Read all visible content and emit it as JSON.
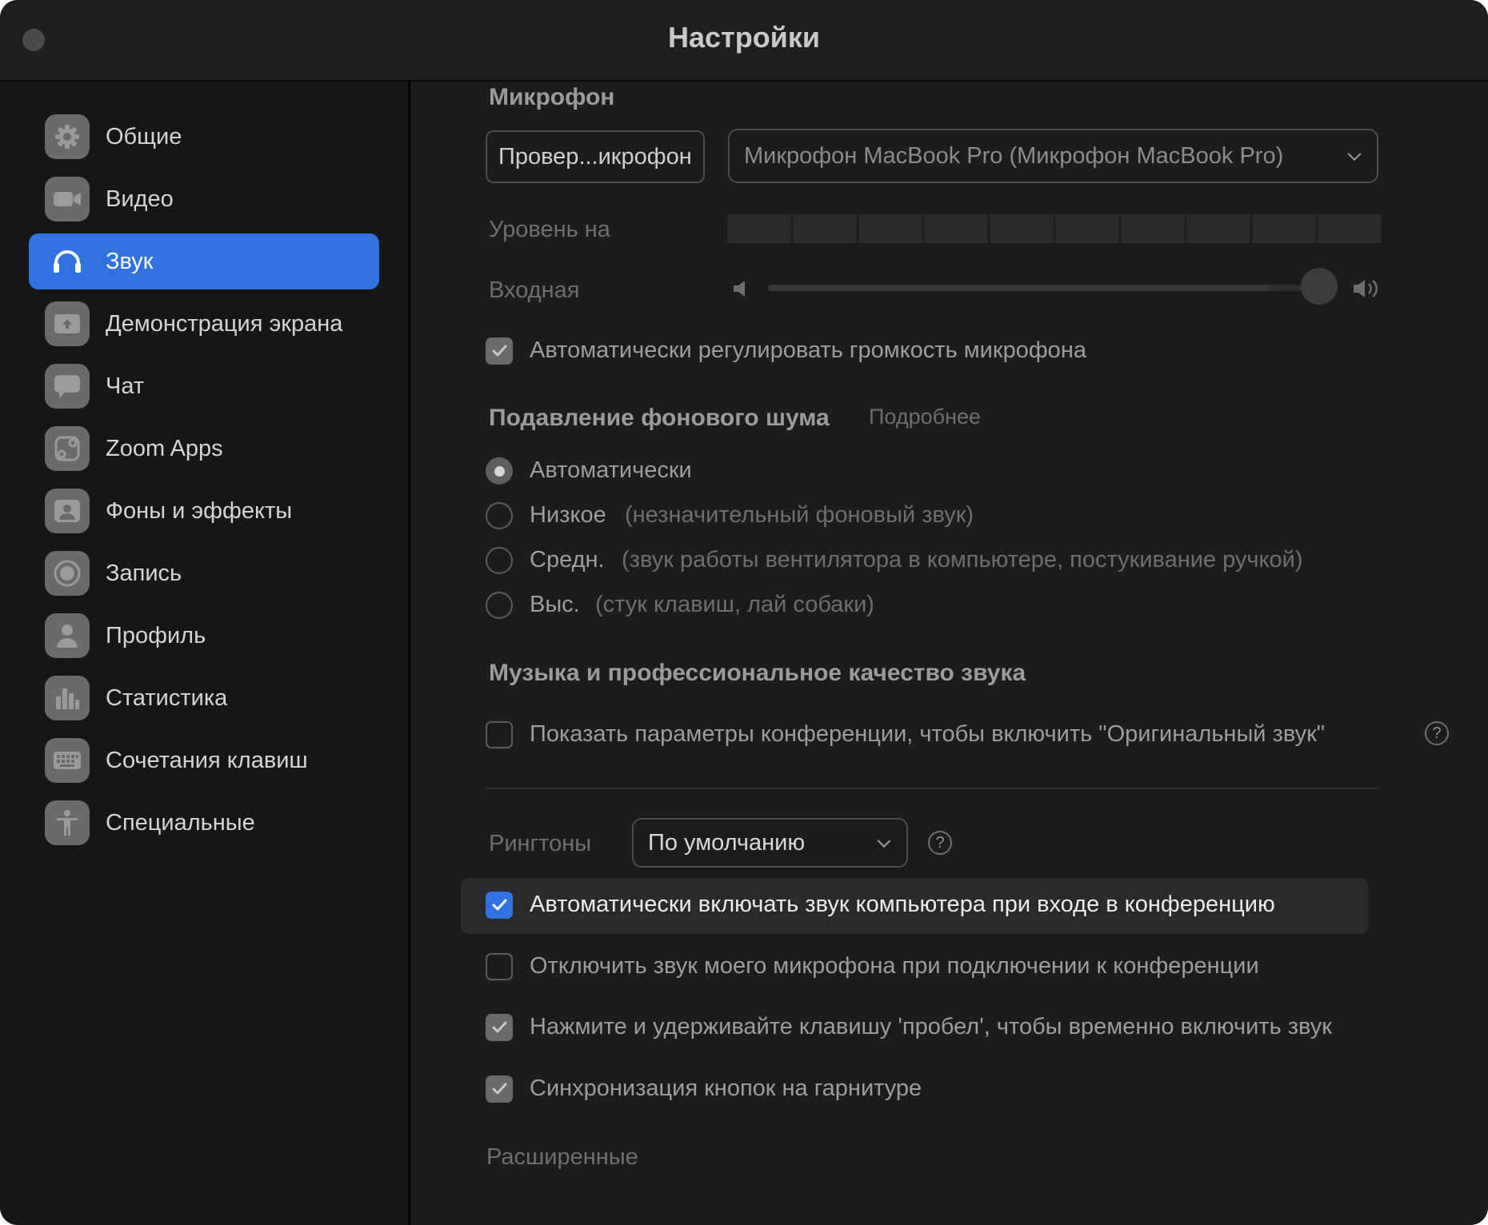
{
  "window": {
    "title": "Настройки"
  },
  "sidebar": {
    "items": [
      {
        "label": "Общие",
        "icon": "gear-icon",
        "active": false
      },
      {
        "label": "Видео",
        "icon": "video-camera-icon",
        "active": false
      },
      {
        "label": "Звук",
        "icon": "headphones-icon",
        "active": true
      },
      {
        "label": "Демонстрация экрана",
        "icon": "share-screen-icon",
        "active": false
      },
      {
        "label": "Чат",
        "icon": "chat-bubble-icon",
        "active": false
      },
      {
        "label": "Zoom Apps",
        "icon": "apps-icon",
        "active": false
      },
      {
        "label": "Фоны и эффекты",
        "icon": "portrait-icon",
        "active": false
      },
      {
        "label": "Запись",
        "icon": "record-icon",
        "active": false
      },
      {
        "label": "Профиль",
        "icon": "person-icon",
        "active": false
      },
      {
        "label": "Статистика",
        "icon": "bar-chart-icon",
        "active": false
      },
      {
        "label": "Сочетания клавиш",
        "icon": "keyboard-icon",
        "active": false
      },
      {
        "label": "Специальные",
        "icon": "accessibility-icon",
        "active": false
      }
    ]
  },
  "microphone": {
    "title": "Микрофон",
    "test_button": "Провер...икрофон",
    "device": "Микрофон MacBook Pro (Микрофон MacBook Pro)",
    "level_label": "Уровень на",
    "input_label": "Входная",
    "input_volume_percent": 92,
    "auto_adjust_label": "Автоматически регулировать громкость микрофона",
    "auto_adjust_checked": true
  },
  "noise": {
    "title": "Подавление фонового шума",
    "more_link": "Подробнее",
    "options": [
      {
        "label": "Автоматически",
        "hint": "",
        "selected": true
      },
      {
        "label": "Низкое",
        "hint": "(незначительный фоновый звук)",
        "selected": false
      },
      {
        "label": "Средн.",
        "hint": "(звук работы вентилятора в компьютере, постукивание ручкой)",
        "selected": false
      },
      {
        "label": "Выс.",
        "hint": "(стук клавиш, лай собаки)",
        "selected": false
      }
    ]
  },
  "music": {
    "title": "Музыка и профессиональное качество звука",
    "original_sound_label": "Показать параметры конференции, чтобы включить \"Оригинальный звук\"",
    "original_sound_checked": false
  },
  "ringtones": {
    "label": "Рингтоны",
    "value": "По умолчанию"
  },
  "options": [
    {
      "label": "Автоматически включать звук компьютера при входе в конференцию",
      "checked": true
    },
    {
      "label": "Отключить звук моего микрофона при подключении к конференции",
      "checked": false
    },
    {
      "label": "Нажмите и удерживайте клавишу 'пробел', чтобы временно включить звук",
      "checked": true
    },
    {
      "label": "Синхронизация кнопок на гарнитуре",
      "checked": true
    }
  ],
  "advanced": {
    "label": "Расширенные"
  },
  "colors": {
    "accent": "#3272e0",
    "sidebar_bg": "#161616",
    "content_bg": "#1c1c1e"
  }
}
